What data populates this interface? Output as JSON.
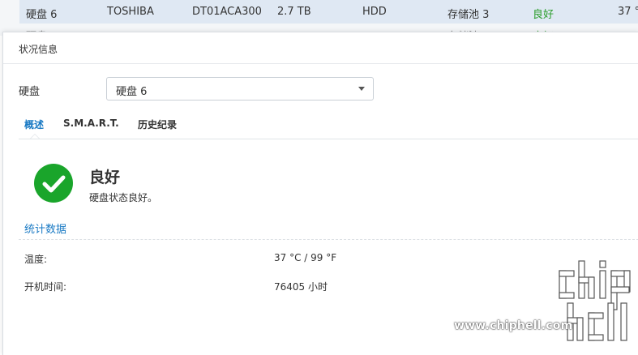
{
  "background_table": {
    "row": {
      "name": "硬盘 6",
      "vendor": "TOSHIBA",
      "model": "DT01ACA300",
      "size": "2.7 TB",
      "type": "HDD",
      "pool": "存储池 3",
      "status": "良好",
      "temp": "37 °"
    },
    "row2": {
      "name": "硬盘",
      "pool": "存储池",
      "status": "良好"
    }
  },
  "dialog": {
    "title": "状况信息",
    "disk_label": "硬盘",
    "disk_selected": "硬盘 6",
    "tabs": [
      {
        "label": "概述"
      },
      {
        "label": "S.M.A.R.T."
      },
      {
        "label": "历史纪录"
      }
    ],
    "status": {
      "title": "良好",
      "description": "硬盘状态良好。",
      "icon": "check-circle-icon",
      "color": "#1aa52b"
    },
    "stats_title": "统计数据",
    "stats": [
      {
        "label": "温度:",
        "value": "37 °C / 99 °F"
      },
      {
        "label": "开机时间:",
        "value": "76405 小时"
      }
    ]
  },
  "watermark": {
    "text": "www.chiphell.com"
  },
  "colors": {
    "accent": "#1a7ac4",
    "good": "#1aa52b",
    "row_highlight": "#dfe8f3"
  }
}
